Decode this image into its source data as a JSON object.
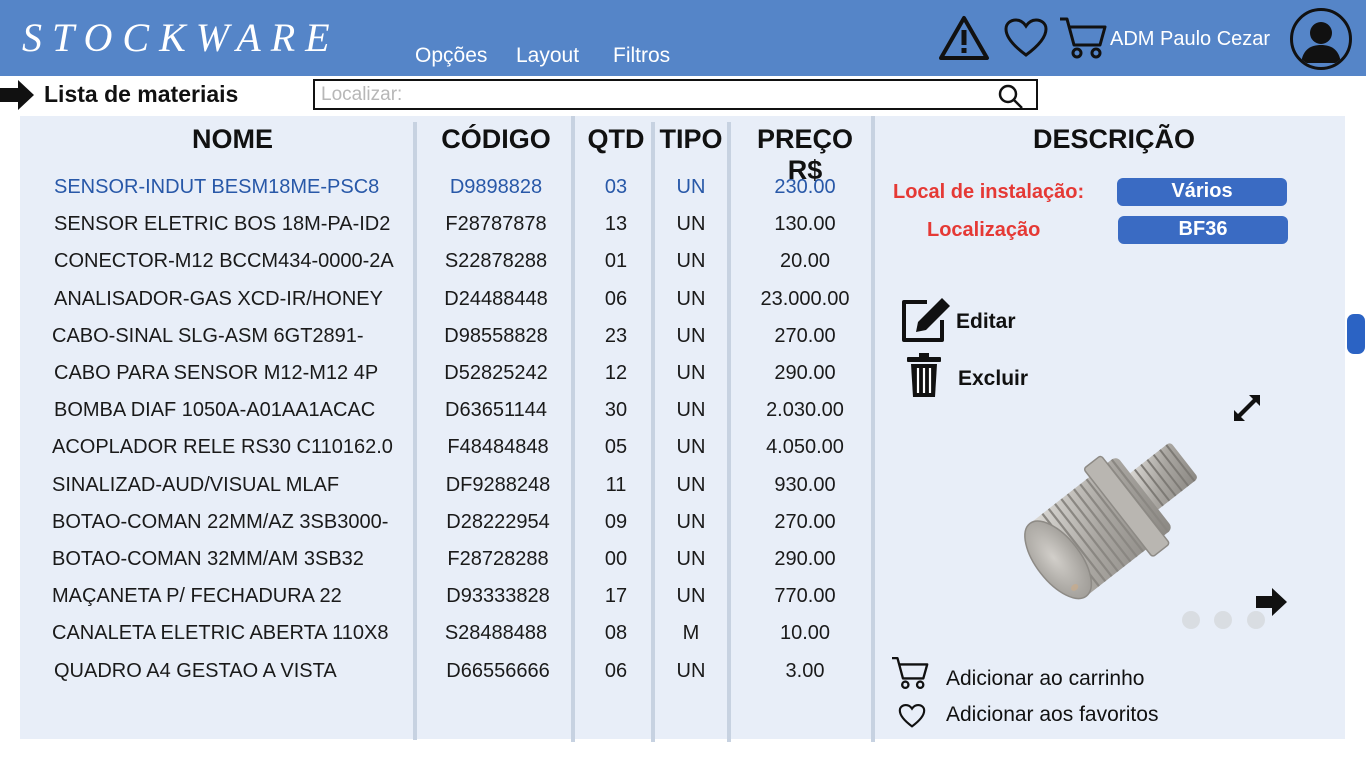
{
  "header": {
    "logo": "STOCKWARE",
    "menu": [
      "Opções",
      "Layout",
      "Filtros"
    ],
    "username": "ADM Paulo Cezar",
    "icons": [
      "alert-triangle-icon",
      "heart-icon",
      "cart-icon",
      "user-avatar-icon"
    ]
  },
  "page": {
    "title": "Lista de materiais"
  },
  "search": {
    "placeholder": "Localizar:"
  },
  "table": {
    "columns": [
      "NOME",
      "CÓDIGO",
      "QTD",
      "TIPO",
      "PREÇO R$"
    ],
    "rows": [
      {
        "nome": "SENSOR-INDUT BESM18ME-PSC8",
        "codigo": "D9898828",
        "qtd": "03",
        "tipo": "UN",
        "preco": "230.00"
      },
      {
        "nome": "SENSOR ELETRIC BOS 18M-PA-ID2",
        "codigo": "F28787878",
        "qtd": "13",
        "tipo": "UN",
        "preco": "130.00"
      },
      {
        "nome": "CONECTOR-M12 BCCM434-0000-2A",
        "codigo": "S22878288",
        "qtd": "01",
        "tipo": "UN",
        "preco": "20.00"
      },
      {
        "nome": "ANALISADOR-GAS XCD-IR/HONEY",
        "codigo": "D24488448",
        "qtd": "06",
        "tipo": "UN",
        "preco": "23.000.00"
      },
      {
        "nome": "CABO-SINAL SLG-ASM 6GT2891-",
        "codigo": "D98558828",
        "qtd": "23",
        "tipo": "UN",
        "preco": "270.00"
      },
      {
        "nome": "CABO PARA SENSOR M12-M12 4P",
        "codigo": "D52825242",
        "qtd": "12",
        "tipo": "UN",
        "preco": "290.00"
      },
      {
        "nome": "BOMBA DIAF 1050A-A01AA1ACAC",
        "codigo": "D63651144",
        "qtd": "30",
        "tipo": "UN",
        "preco": "2.030.00"
      },
      {
        "nome": "ACOPLADOR RELE RS30 C110162.0",
        "codigo": "F48484848",
        "qtd": "05",
        "tipo": "UN",
        "preco": "4.050.00"
      },
      {
        "nome": "SINALIZAD-AUD/VISUAL MLAF",
        "codigo": "DF9288248",
        "qtd": "11",
        "tipo": "UN",
        "preco": "930.00"
      },
      {
        "nome": "BOTAO-COMAN 22MM/AZ 3SB3000-",
        "codigo": "D28222954",
        "qtd": "09",
        "tipo": "UN",
        "preco": "270.00"
      },
      {
        "nome": "BOTAO-COMAN 32MM/AM 3SB32",
        "codigo": "F28728288",
        "qtd": "00",
        "tipo": "UN",
        "preco": "290.00"
      },
      {
        "nome": "MAÇANETA P/ FECHADURA 22",
        "codigo": "D93333828",
        "qtd": "17",
        "tipo": "UN",
        "preco": "770.00"
      },
      {
        "nome": "CANALETA ELETRIC ABERTA 110X8",
        "codigo": "S28488488",
        "qtd": "08",
        "tipo": "M",
        "preco": "10.00"
      },
      {
        "nome": "QUADRO A4 GESTAO A VISTA",
        "codigo": "D66556666",
        "qtd": "06",
        "tipo": "UN",
        "preco": "3.00"
      }
    ]
  },
  "description": {
    "title": "DESCRIÇÃO",
    "install_label": "Local de instalação:",
    "install_value": "Vários",
    "location_label": "Localização",
    "location_value": "BF36",
    "edit_label": "Editar",
    "delete_label": "Excluir",
    "add_cart_label": "Adicionar ao carrinho",
    "add_fav_label": "Adicionar aos favoritos",
    "image_icon": "inductive-sensor-image",
    "carousel_pages": 3
  },
  "colors": {
    "topbar": "#5585c8",
    "panel": "#e8eef8",
    "selected_text": "#2858a8",
    "label_red": "#e53935",
    "badge": "#3a6bc3"
  }
}
